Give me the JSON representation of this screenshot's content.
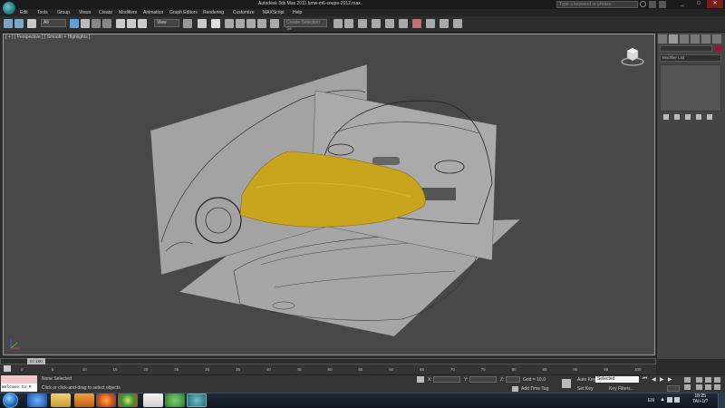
{
  "window": {
    "title": "Autodesk 3ds Max 2011    bmw-m6-coupe-2012.max",
    "search_placeholder": "Type a keyword or phrase"
  },
  "menu": [
    "Edit",
    "Tools",
    "Group",
    "Views",
    "Create",
    "Modifiers",
    "Animation",
    "Graph Editors",
    "Rendering",
    "Customize",
    "MAXScript",
    "Help"
  ],
  "toolbar": {
    "selection_filter": "All",
    "reference_coord": "View",
    "named_selection": "Create Selection Se"
  },
  "viewport": {
    "label": "[ + ] [ Perspective ] [ Smooth + Highlights ]"
  },
  "command_panel": {
    "modifier_list": "Modifier List"
  },
  "timeline": {
    "frame_indicator": "0 / 100",
    "ticks": [
      "0",
      "5",
      "10",
      "15",
      "20",
      "25",
      "30",
      "35",
      "40",
      "45",
      "50",
      "55",
      "60",
      "65",
      "70",
      "75",
      "80",
      "85",
      "90",
      "95",
      "100"
    ]
  },
  "status": {
    "maxscript_text": "Welcome to M",
    "selection": "None Selected",
    "prompt": "Click or click-and-drag to select objects",
    "x_label": "X:",
    "y_label": "Y:",
    "z_label": "Z:",
    "grid": "Grid = 10.0",
    "add_time_tag": "Add Time Tag",
    "auto_key": "Auto Key",
    "set_key": "Set Key",
    "selected_dropdown": "Selected",
    "key_filters": "Key Filters..."
  },
  "taskbar": {
    "language": "EN",
    "time": "18:25",
    "date": "TA/+1/?",
    "apps": [
      "ie-icon",
      "explorer-icon",
      "media-player-icon",
      "firefox-icon",
      "chrome-icon",
      "app-icon",
      "utorrent-icon",
      "3dsmax-icon"
    ]
  }
}
